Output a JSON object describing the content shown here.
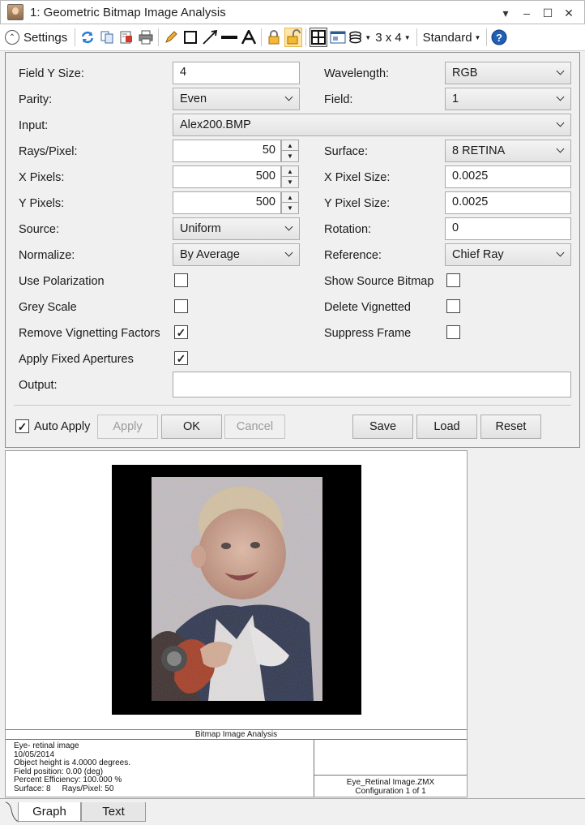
{
  "window": {
    "title": "1: Geometric Bitmap Image Analysis"
  },
  "toolbar": {
    "settings_label": "Settings",
    "layout_label": "3 x 4",
    "style_label": "Standard"
  },
  "form": {
    "field_y_size": {
      "label": "Field Y Size:",
      "value": "4"
    },
    "wavelength": {
      "label": "Wavelength:",
      "value": "RGB"
    },
    "parity": {
      "label": "Parity:",
      "value": "Even"
    },
    "field": {
      "label": "Field:",
      "value": "1"
    },
    "input": {
      "label": "Input:",
      "value": "Alex200.BMP"
    },
    "rays_pixel": {
      "label": "Rays/Pixel:",
      "value": "50"
    },
    "surface": {
      "label": "Surface:",
      "value": "8 RETINA"
    },
    "x_pixels": {
      "label": "X Pixels:",
      "value": "500"
    },
    "x_pixel_size": {
      "label": "X Pixel Size:",
      "value": "0.0025"
    },
    "y_pixels": {
      "label": "Y Pixels:",
      "value": "500"
    },
    "y_pixel_size": {
      "label": "Y Pixel Size:",
      "value": "0.0025"
    },
    "source": {
      "label": "Source:",
      "value": "Uniform"
    },
    "rotation": {
      "label": "Rotation:",
      "value": "0"
    },
    "normalize": {
      "label": "Normalize:",
      "value": "By Average"
    },
    "reference": {
      "label": "Reference:",
      "value": "Chief Ray"
    },
    "use_polarization": {
      "label": "Use Polarization",
      "checked": false
    },
    "show_source_bitmap": {
      "label": "Show Source Bitmap",
      "checked": false
    },
    "grey_scale": {
      "label": "Grey Scale",
      "checked": false
    },
    "delete_vignetted": {
      "label": "Delete Vignetted",
      "checked": false
    },
    "remove_vignetting": {
      "label": "Remove Vignetting Factors",
      "checked": true
    },
    "suppress_frame": {
      "label": "Suppress Frame",
      "checked": false
    },
    "apply_fixed_apertures": {
      "label": "Apply Fixed Apertures",
      "checked": true
    },
    "output": {
      "label": "Output:",
      "value": ""
    }
  },
  "actions": {
    "auto_apply": {
      "label": "Auto Apply",
      "checked": true
    },
    "apply": "Apply",
    "ok": "OK",
    "cancel": "Cancel",
    "save": "Save",
    "load": "Load",
    "reset": "Reset"
  },
  "graph": {
    "title": "Bitmap Image Analysis",
    "info_lines": [
      "Eye- retinal image",
      "10/05/2014",
      "Object height is 4.0000 degrees.",
      "Field position: 0.00 (deg)",
      "Percent Efficiency: 100.000 %",
      "Surface: 8     Rays/Pixel: 50"
    ],
    "file_name": "Eye_Retinal Image.ZMX",
    "configuration": "Configuration 1 of 1"
  },
  "tabs": [
    {
      "label": "Graph",
      "active": true
    },
    {
      "label": "Text",
      "active": false
    }
  ],
  "colors": {
    "lock_accent": "#f5b830",
    "help_blue": "#1f5fb5",
    "refresh_blue": "#2a7ad5"
  }
}
